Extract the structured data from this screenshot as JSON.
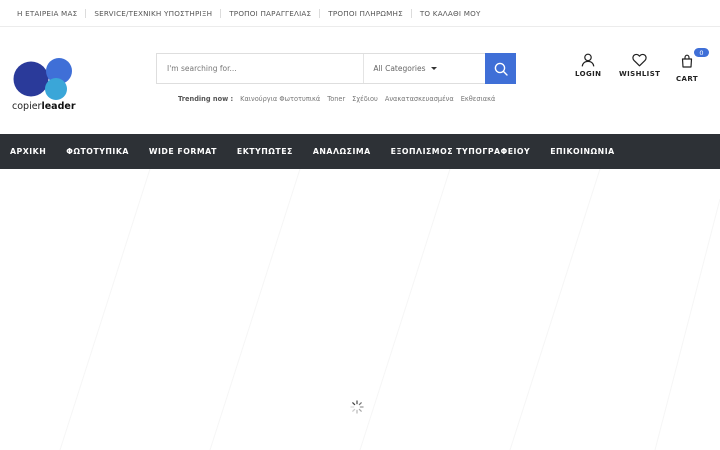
{
  "topbar": {
    "links": [
      "Η ΕΤΑΙΡΕΙΑ ΜΑΣ",
      "SERVICE/ΤΕΧΝΙΚΗ ΥΠΟΣΤΗΡΙΞΗ",
      "ΤΡΟΠΟΙ ΠΑΡΑΓΓΕΛΙΑΣ",
      "ΤΡΟΠΟΙ ΠΛΗΡΩΜΗΣ",
      "ΤΟ ΚΑΛΑΘΙ ΜΟΥ"
    ]
  },
  "logo": {
    "text_regular": "copier",
    "text_bold": "leader",
    "colors": {
      "navy": "#2a3a9a",
      "blue": "#3f6fd7",
      "cyan": "#3aa6d8"
    }
  },
  "search": {
    "placeholder": "I'm searching for...",
    "category": "All Categories",
    "button_icon": "search-icon"
  },
  "trending": {
    "label": "Trending now :",
    "items": [
      "Καινούργια Φωτοτυπικά",
      "Toner",
      "Σχέδιου",
      "Ανακατασκευασμένα",
      "Εκθεσιακά"
    ]
  },
  "header_actions": {
    "login": {
      "label": "LOGIN",
      "icon": "user-icon"
    },
    "wishlist": {
      "label": "WISHLIST",
      "icon": "heart-icon"
    },
    "cart": {
      "label": "CART",
      "icon": "bag-icon",
      "count": "0"
    }
  },
  "nav": {
    "items": [
      "ΑΡΧΙΚΗ",
      "ΦΩΤΟΤΥΠΙΚΑ",
      "WIDE FORMAT",
      "ΕΚΤΥΠΩΤΕΣ",
      "ΑΝΑΛΩΣΙΜΑ",
      "ΕΞΟΠΛΙΣΜΟΣ ΤΥΠΟΓΡΑΦΕΙΟΥ",
      "ΕΠΙΚΟΙΝΩΝΙΑ"
    ]
  },
  "theme": {
    "accent": "#3f6fd7",
    "nav_bg": "#2d3136"
  },
  "content": {
    "loader_icon": "spinner-icon"
  }
}
